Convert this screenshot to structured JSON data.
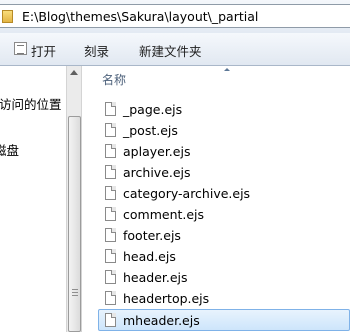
{
  "address": {
    "path": "E:\\Blog\\themes\\Sakura\\layout\\_partial",
    "icon": "folder-icon"
  },
  "toolbar": {
    "open_label": "打开",
    "burn_label": "刻录",
    "new_folder_label": "新建文件夹"
  },
  "nav_pane": {
    "items": [
      "访问的位置",
      "磁盘"
    ]
  },
  "file_list": {
    "column_name": "名称",
    "files": [
      "_page.ejs",
      "_post.ejs",
      "aplayer.ejs",
      "archive.ejs",
      "category-archive.ejs",
      "comment.ejs",
      "footer.ejs",
      "head.ejs",
      "header.ejs",
      "headertop.ejs",
      "mheader.ejs"
    ],
    "selected": "mheader.ejs",
    "selection_color": "#cde5fb"
  }
}
